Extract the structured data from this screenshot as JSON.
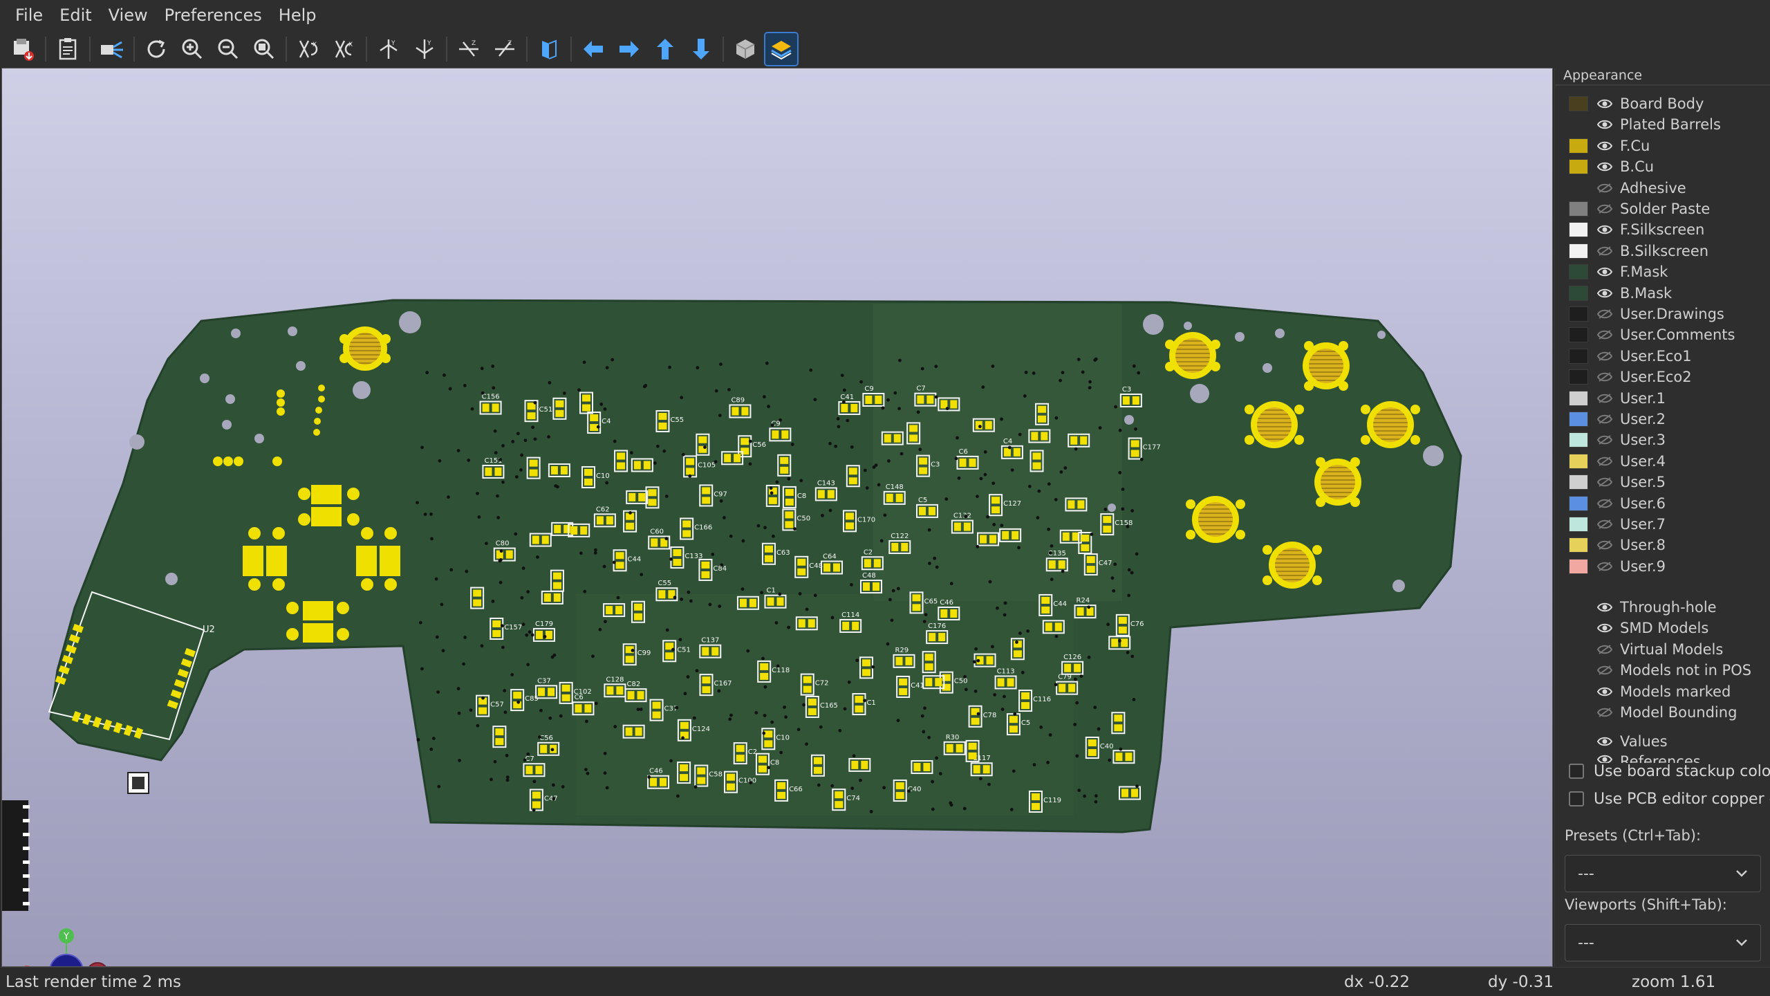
{
  "menu": {
    "items": [
      "File",
      "Edit",
      "View",
      "Preferences",
      "Help"
    ]
  },
  "toolbar": {
    "buttons": [
      {
        "icon": "export-icon"
      },
      {
        "icon": "copy-clipboard-icon"
      },
      {
        "icon": "raytrace-render-icon"
      },
      {
        "icon": "refresh-icon"
      },
      {
        "icon": "zoom-in-icon"
      },
      {
        "icon": "zoom-out-icon"
      },
      {
        "icon": "zoom-fit-icon"
      },
      {
        "icon": "rotate-x-cw-icon"
      },
      {
        "icon": "rotate-x-ccw-icon"
      },
      {
        "icon": "rotate-y-cw-icon"
      },
      {
        "icon": "rotate-y-ccw-icon"
      },
      {
        "icon": "rotate-z-cw-icon"
      },
      {
        "icon": "rotate-z-ccw-icon"
      },
      {
        "icon": "flip-board-icon"
      },
      {
        "icon": "move-left-icon"
      },
      {
        "icon": "move-right-icon"
      },
      {
        "icon": "move-up-icon"
      },
      {
        "icon": "move-down-icon"
      },
      {
        "icon": "ortho-projection-icon"
      },
      {
        "icon": "appearance-layers-icon"
      }
    ]
  },
  "panel": {
    "title": "Appearance",
    "layers": [
      {
        "name": "Board Body",
        "color": "#4a3f1e",
        "visible": true
      },
      {
        "name": "Plated Barrels",
        "color": "",
        "visible": true
      },
      {
        "name": "F.Cu",
        "color": "#c7aa10",
        "visible": true
      },
      {
        "name": "B.Cu",
        "color": "#c7aa10",
        "visible": true
      },
      {
        "name": "Adhesive",
        "color": "",
        "visible": false
      },
      {
        "name": "Solder Paste",
        "color": "#808080",
        "visible": false
      },
      {
        "name": "F.Silkscreen",
        "color": "#f2f2f2",
        "visible": true
      },
      {
        "name": "B.Silkscreen",
        "color": "#f2f2f2",
        "visible": false
      },
      {
        "name": "F.Mask",
        "color": "#2d4a36",
        "visible": true
      },
      {
        "name": "B.Mask",
        "color": "#2d4a36",
        "visible": true
      },
      {
        "name": "User.Drawings",
        "color": "#1e1e1e",
        "visible": false
      },
      {
        "name": "User.Comments",
        "color": "#1e1e1e",
        "visible": false
      },
      {
        "name": "User.Eco1",
        "color": "#1e1e1e",
        "visible": false
      },
      {
        "name": "User.Eco2",
        "color": "#1e1e1e",
        "visible": false
      },
      {
        "name": "User.1",
        "color": "#cfcfcf",
        "visible": false
      },
      {
        "name": "User.2",
        "color": "#5b8fe0",
        "visible": false
      },
      {
        "name": "User.3",
        "color": "#bfe6dc",
        "visible": false
      },
      {
        "name": "User.4",
        "color": "#e6d25a",
        "visible": false
      },
      {
        "name": "User.5",
        "color": "#cfcfcf",
        "visible": false
      },
      {
        "name": "User.6",
        "color": "#5b8fe0",
        "visible": false
      },
      {
        "name": "User.7",
        "color": "#bfe6dc",
        "visible": false
      },
      {
        "name": "User.8",
        "color": "#e6d25a",
        "visible": false
      },
      {
        "name": "User.9",
        "color": "#f0a8a0",
        "visible": false
      }
    ],
    "objects": [
      {
        "name": "Through-hole",
        "visible": true
      },
      {
        "name": "SMD Models",
        "visible": true
      },
      {
        "name": "Virtual Models",
        "visible": false
      },
      {
        "name": "Models not in POS",
        "visible": false
      },
      {
        "name": "Models marked",
        "visible": true
      },
      {
        "name": "Model Bounding",
        "visible": false
      },
      {
        "name": "Values",
        "visible": true
      },
      {
        "name": "References",
        "visible": true
      }
    ],
    "checkboxes": [
      {
        "label": "Use board stackup colors",
        "checked": false
      },
      {
        "label": "Use PCB editor copper c",
        "checked": false
      }
    ],
    "presets_label": "Presets (Ctrl+Tab):",
    "presets_value": "---",
    "viewports_label": "Viewports (Shift+Tab):",
    "viewports_value": "---"
  },
  "status": {
    "render_time": "Last render time 2 ms",
    "dx": "dx -0.22",
    "dy": "dy -0.31",
    "zoom": "zoom 1.61"
  },
  "axes": {
    "x_label": "X",
    "y_label": "Y"
  },
  "pcb": {
    "board_color": "#2f5236",
    "pad_color": "#f2e000",
    "silk_color": "#f5f5f5",
    "refdes_labels": [
      "C1",
      "C2",
      "C3",
      "C4",
      "C5",
      "C6",
      "C7",
      "C8",
      "C9",
      "C10",
      "C37",
      "C40",
      "C41",
      "C44",
      "C46",
      "C47",
      "C48",
      "C50",
      "C51",
      "C55",
      "C56",
      "C57",
      "C58",
      "C60",
      "C62",
      "C63",
      "C64",
      "C65",
      "C66",
      "C72",
      "C74",
      "C76",
      "C78",
      "C79",
      "C80",
      "C82",
      "C84",
      "C85",
      "C89",
      "C97",
      "C99",
      "C100",
      "C102",
      "C105",
      "C113",
      "C114",
      "C116",
      "C117",
      "C118",
      "C119",
      "C122",
      "C124",
      "C126",
      "C127",
      "C128",
      "C132",
      "C133",
      "C135",
      "C137",
      "C143",
      "C148",
      "C151",
      "C156",
      "C157",
      "C158",
      "C165",
      "C166",
      "C167",
      "C170",
      "C176",
      "C177",
      "C179",
      "R24",
      "R29",
      "R30",
      "U2"
    ]
  }
}
